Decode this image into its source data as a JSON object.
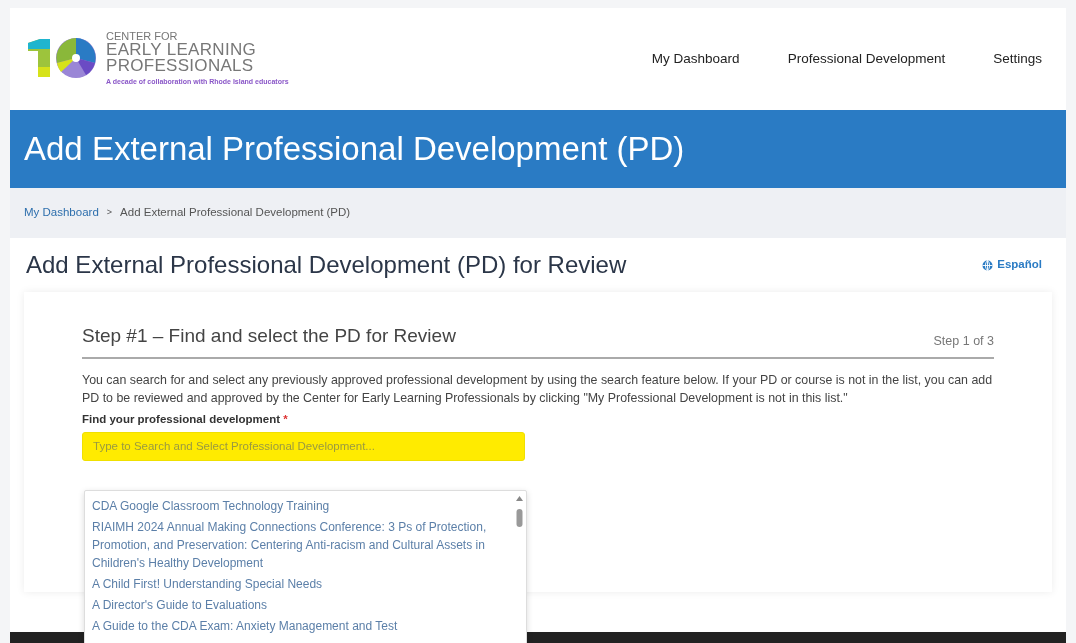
{
  "header": {
    "logo": {
      "line_1": "CENTER FOR",
      "line_2": "EARLY LEARNING",
      "line_3": "PROFESSIONALS",
      "tagline": "A decade of collaboration with Rhode Island educators"
    },
    "nav": [
      {
        "label": "My Dashboard"
      },
      {
        "label": "Professional Development"
      },
      {
        "label": "Settings"
      }
    ]
  },
  "banner": {
    "title": "Add External Professional Development (PD)"
  },
  "breadcrumb": [
    {
      "label": "My Dashboard",
      "link": true
    },
    {
      "label": "Add External Professional Development (PD)",
      "link": false
    }
  ],
  "breadcrumb_separator": ">",
  "page_heading": "Add External Professional Development (PD) for Review",
  "language_link": "Español",
  "step": {
    "title": "Step #1 – Find and select the PD for Review",
    "counter": "Step 1 of 3",
    "intro": "You can search for and select any previously approved professional development by using the search feature below. If your PD or course is not in the list, you can add PD to be reviewed and approved by the Center for Early Learning Professionals by clicking \"My Professional Development is not in this list.\"",
    "field_label": "Find your professional development",
    "required_mark": "*",
    "field": {
      "placeholder": "Type to Search and Select Professional Development...",
      "highlighted": true
    },
    "options": [
      {
        "label": "CDA Google Classroom Technology Training"
      },
      {
        "label": "RIAIMH 2024 Annual Making Connections Conference: 3 Ps of Protection, Promotion, and Preservation: Centering Anti-racism and Cultural Assets in Children's Healthy Development"
      },
      {
        "label": "A Child First! Understanding Special Needs"
      },
      {
        "label": "A Director's Guide to Evaluations"
      },
      {
        "label": "A Guide to the CDA Exam: Anxiety Management and Test"
      }
    ]
  }
}
